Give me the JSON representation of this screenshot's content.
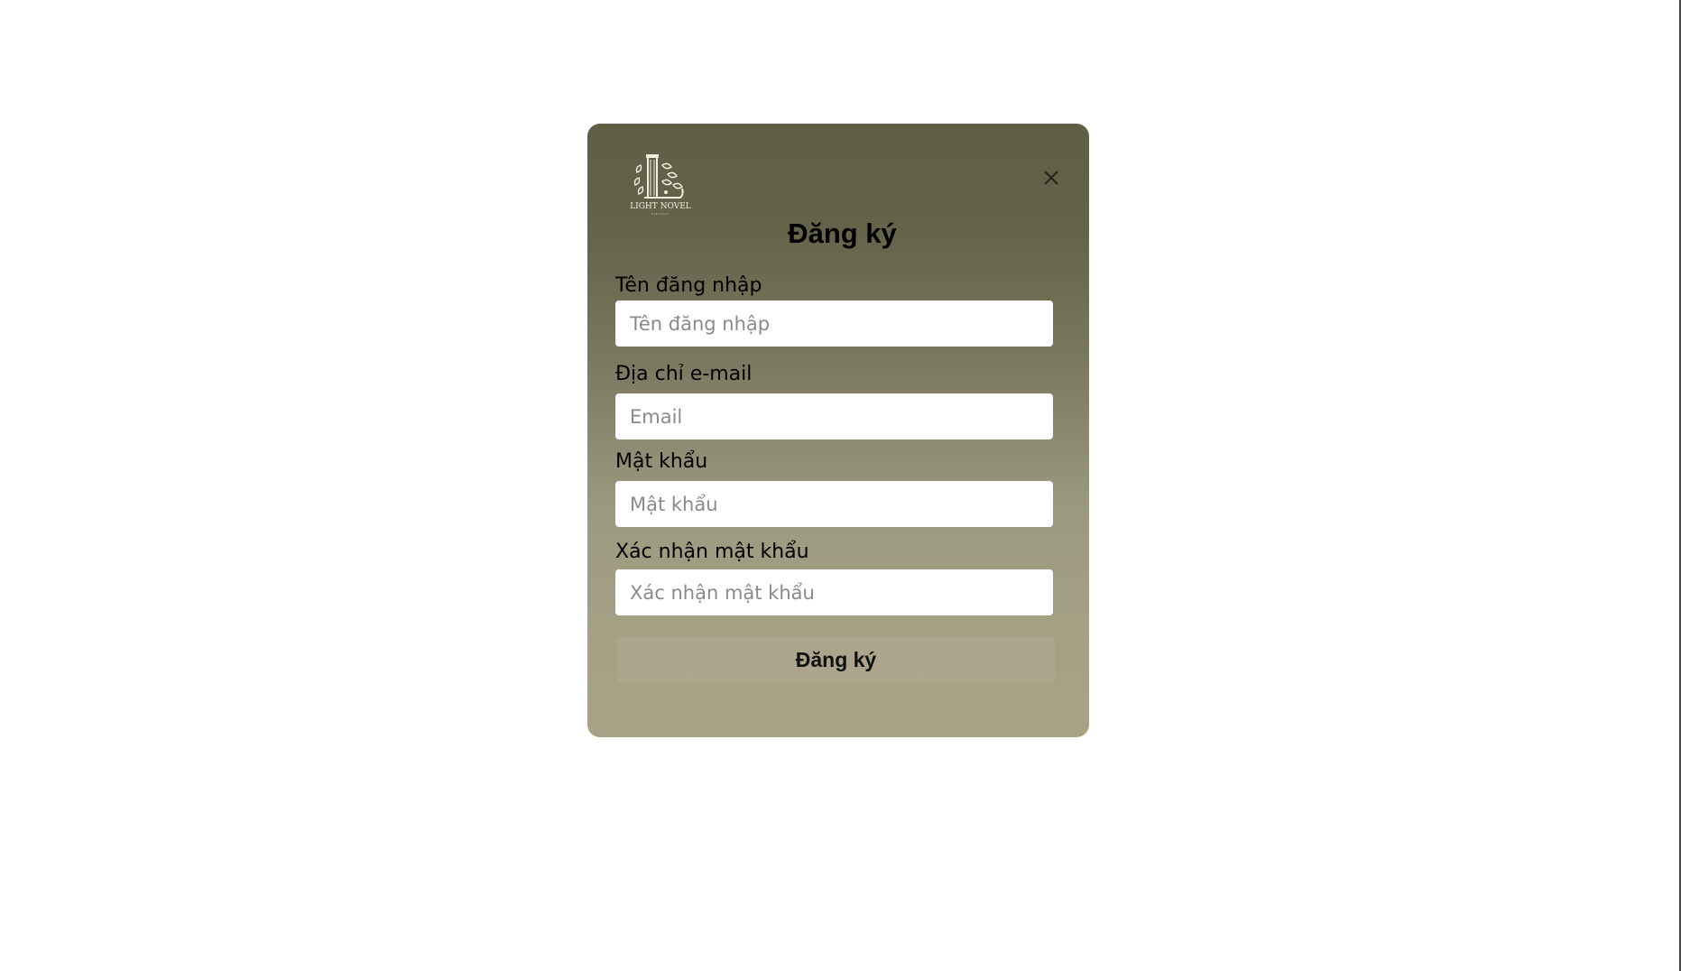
{
  "modal": {
    "title": "Đăng ký",
    "close_icon": "close-icon",
    "logo": {
      "icon": "light-novel-logo",
      "text": "LIGHT NOVEL"
    }
  },
  "form": {
    "username": {
      "label": "Tên đăng nhập",
      "placeholder": "Tên đăng nhập",
      "value": ""
    },
    "email": {
      "label": "Địa chỉ e-mail",
      "placeholder": "Email",
      "value": ""
    },
    "password": {
      "label": "Mật khẩu",
      "placeholder": "Mật khẩu",
      "value": ""
    },
    "confirm_password": {
      "label": "Xác nhận mật khẩu",
      "placeholder": "Xác nhận mật khẩu",
      "value": ""
    },
    "submit_label": "Đăng ký"
  },
  "colors": {
    "modal_top": "#5f5f45",
    "modal_bottom": "#a7a286",
    "input_bg": "#ffffff",
    "text": "#000000"
  }
}
